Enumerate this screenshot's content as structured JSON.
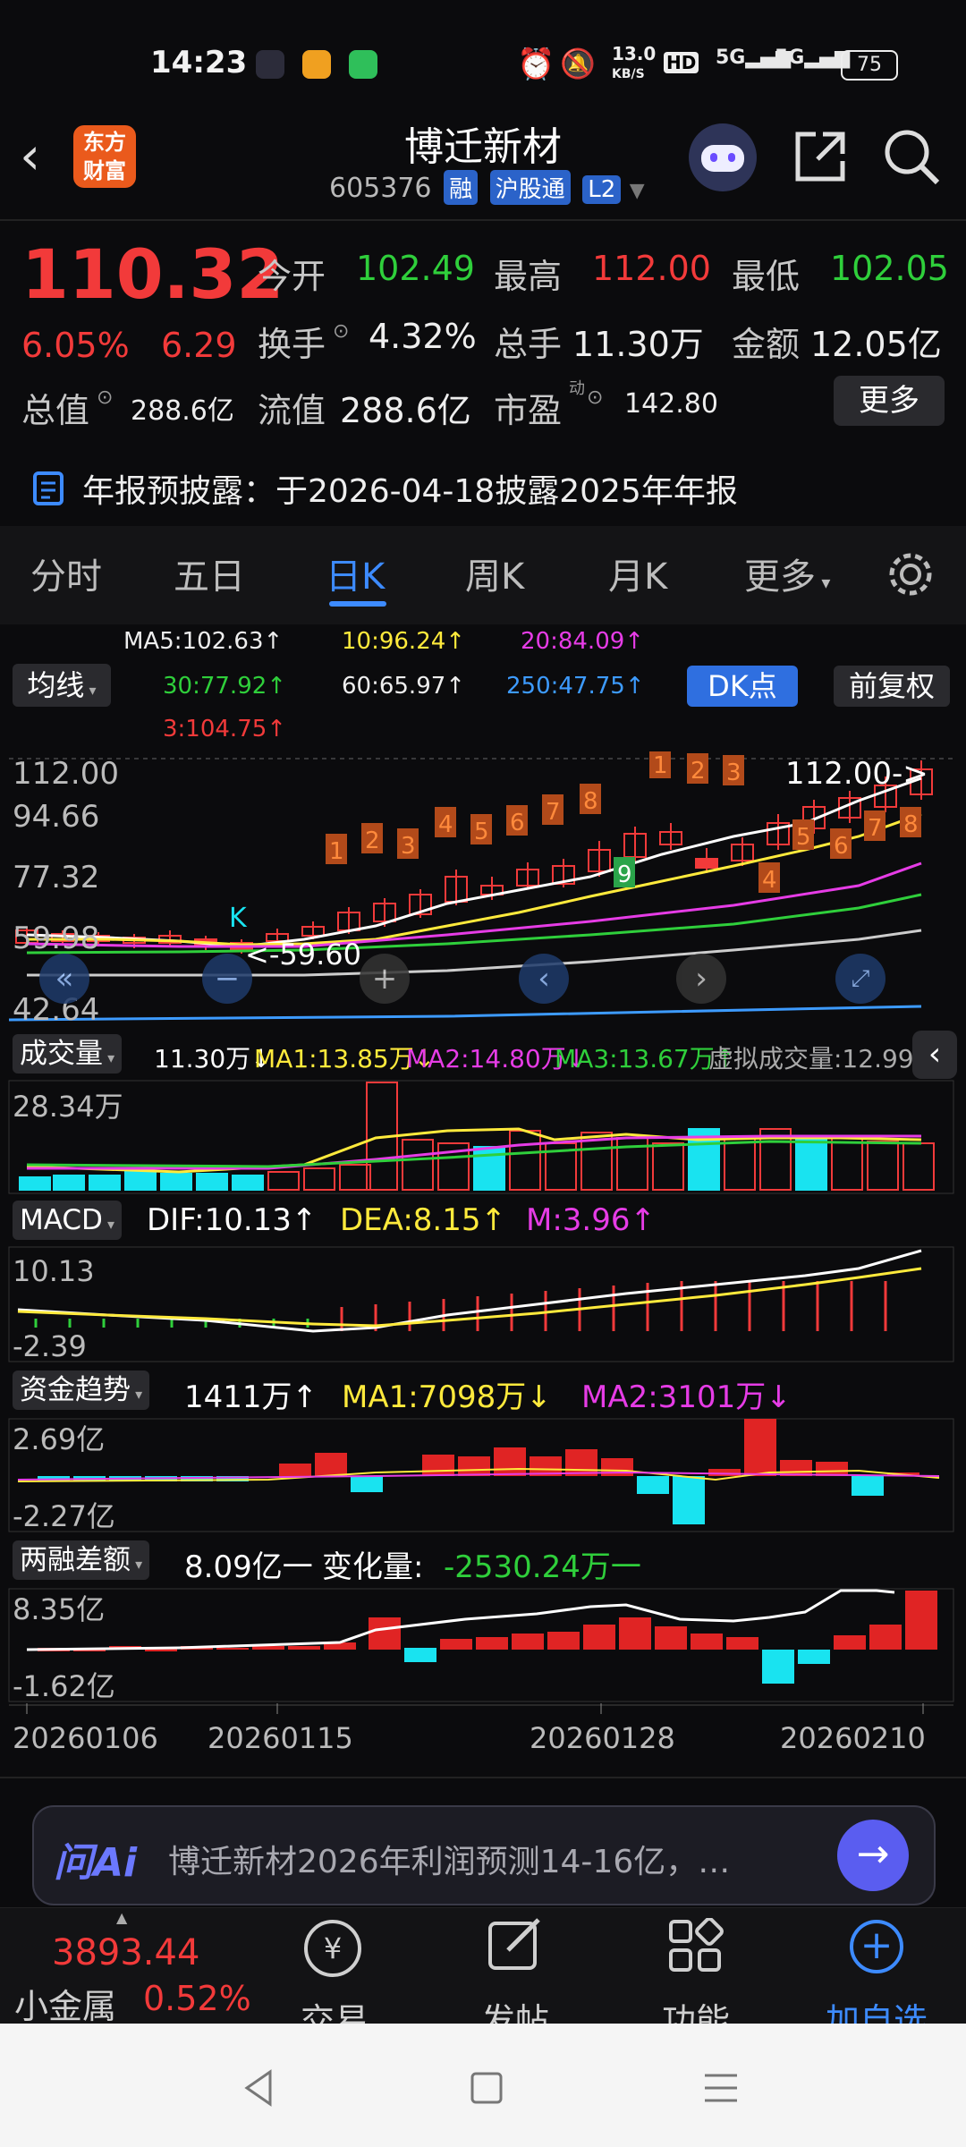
{
  "status": {
    "time": "14:23",
    "net": "13.0",
    "net_unit": "KB/S",
    "sig1": "5G",
    "sig2": "5G",
    "battery": "75"
  },
  "header": {
    "logo_line1": "东方",
    "logo_line2": "财富",
    "title": "博迁新材",
    "code": "605376",
    "tag_rong": "融",
    "tag_hgt": "沪股通",
    "tag_l2": "L2"
  },
  "quote": {
    "price": "110.32",
    "pct": "6.05%",
    "chg": "6.29",
    "open_label": "今开",
    "open": "102.49",
    "high_label": "最高",
    "high": "112.00",
    "low_label": "最低",
    "low": "102.05",
    "turnover_label": "换手",
    "turnover": "4.32%",
    "volume_label": "总手",
    "volume": "11.30万",
    "amount_label": "金额",
    "amount": "12.05亿",
    "mktcap_label": "总值",
    "mktcap": "288.6亿",
    "float_label": "流值",
    "float": "288.6亿",
    "pe_label": "市盈",
    "pe_sup": "动",
    "pe": "142.80",
    "more_label": "更多"
  },
  "notice": {
    "text": "年报预披露：于2026-04-18披露2025年年报"
  },
  "tabs": [
    "分时",
    "五日",
    "日K",
    "周K",
    "月K",
    "更多"
  ],
  "kline": {
    "ma_button": "均线",
    "dk_button": "DK点",
    "fq_button": "前复权",
    "ma5": "MA5:102.63↑",
    "ma10": "10:96.24↑",
    "ma20": "20:84.09↑",
    "ma30": "30:77.92↑",
    "ma60": "60:65.97↑",
    "ma250": "250:47.75↑",
    "ma3": "3:104.75↑",
    "y_labels": [
      "112.00",
      "94.66",
      "77.32",
      "59.98",
      "42.64"
    ],
    "high_mark": "112.00->",
    "low_mark": "<-59.60",
    "k_label": "K",
    "num_labels": [
      "1",
      "2",
      "3",
      "4",
      "5",
      "6",
      "7",
      "8",
      "1",
      "2",
      "3",
      "9",
      "4",
      "5",
      "6",
      "7",
      "8"
    ]
  },
  "volume": {
    "label": "成交量",
    "v": "11.30万↓",
    "ma1": "MA1:13.85万↓",
    "ma2": "MA2:14.80万↓",
    "ma3": "MA3:13.67万↑",
    "virtual": "虚拟成交量:12.99万",
    "y_label": "28.34万"
  },
  "macd": {
    "label": "MACD",
    "dif": "DIF:10.13↑",
    "dea": "DEA:8.15↑",
    "m": "M:3.96↑",
    "y_top": "10.13",
    "y_bot": "-2.39"
  },
  "fund": {
    "label": "资金趋势",
    "v": "1411万↑",
    "ma1": "MA1:7098万↓",
    "ma2": "MA2:3101万↓",
    "y_top": "2.69亿",
    "y_bot": "-2.27亿"
  },
  "margin": {
    "label": "两融差额",
    "v": "8.09亿一",
    "chg_label": "变化量:",
    "chg": "-2530.24万一",
    "y_top": "8.35亿",
    "y_bot": "-1.62亿"
  },
  "dates": [
    "20260106",
    "20260115",
    "20260128",
    "20260210"
  ],
  "ai": {
    "logo": "问Ai",
    "text": "博迁新材2026年利润预测14-16亿，…"
  },
  "bottom": {
    "index_value": "3893.44",
    "index_name": "小金属",
    "index_pct": "0.52%",
    "trade": "交易",
    "post": "发帖",
    "func": "功能",
    "add": "加自选"
  },
  "colors": {
    "up": "#f23a3a",
    "down": "#2fcf3b",
    "accent": "#3d8bff",
    "cyan": "#19e3f0",
    "yellow": "#ffea3c",
    "magenta": "#e63ce6"
  }
}
